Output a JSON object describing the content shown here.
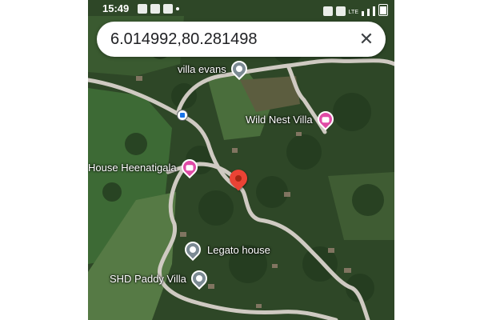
{
  "status_bar": {
    "time": "15:49",
    "app_icons": [
      "whatsapp-icon",
      "facebook-icon",
      "gallery-icon"
    ],
    "network_label": "LTE"
  },
  "search": {
    "query": "6.014992,80.281498",
    "close_icon": "close-icon"
  },
  "places": [
    {
      "name": "villa evans",
      "type": "place"
    },
    {
      "name": "Wild Nest Villa",
      "type": "hotel"
    },
    {
      "name": "House Heenatigala",
      "type": "hotel"
    },
    {
      "name": "Legato house",
      "type": "place"
    },
    {
      "name": "SHD Paddy Villa",
      "type": "place"
    }
  ],
  "marker": {
    "kind": "dropped-pin",
    "color": "#ea4335"
  },
  "colors": {
    "hotel_pin": "#e04ba6",
    "place_pin": "#7b8a93",
    "road": "#cfcac2"
  }
}
